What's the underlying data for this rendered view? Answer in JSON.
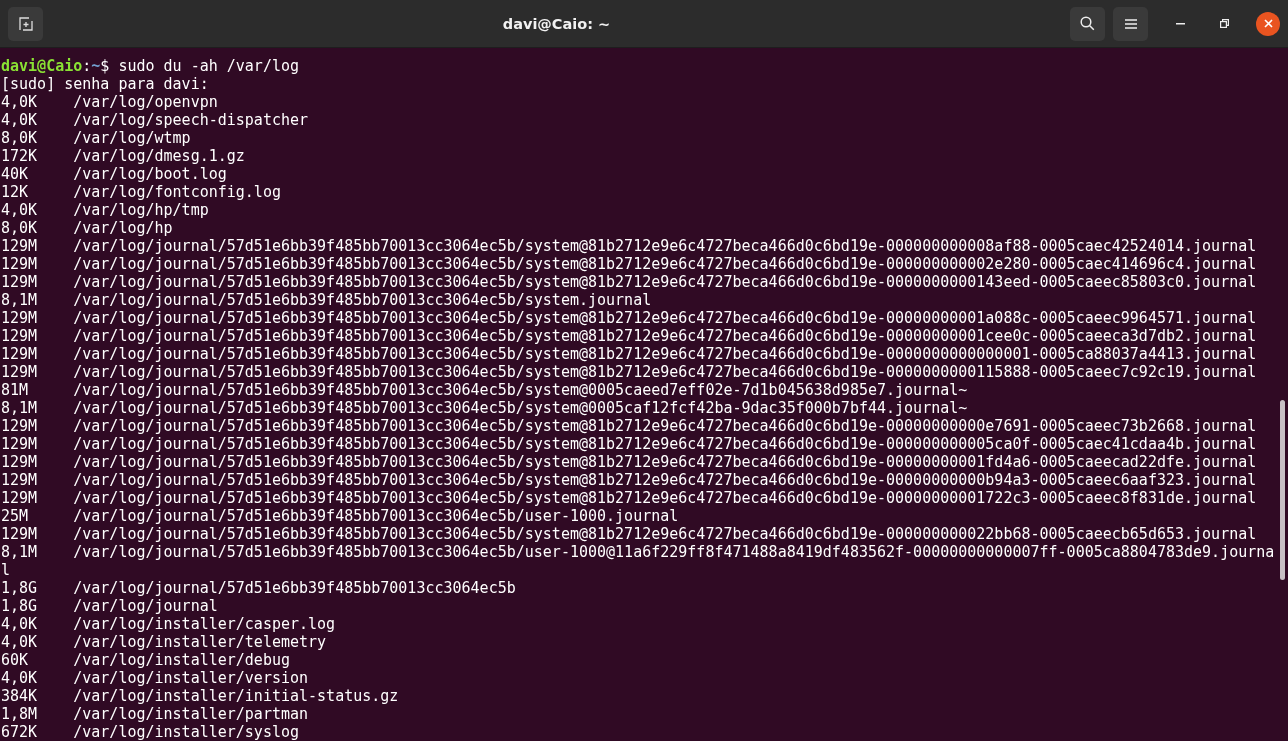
{
  "window": {
    "title": "davi@Caio: ~"
  },
  "prompt": {
    "user_host": "davi@Caio",
    "separator": ":",
    "cwd": "~",
    "symbol": "$",
    "command": "sudo du -ah /var/log"
  },
  "output": [
    {
      "kind": "text",
      "text": "[sudo] senha para davi:"
    },
    {
      "kind": "entry",
      "size": "4,0K",
      "path": "/var/log/openvpn"
    },
    {
      "kind": "entry",
      "size": "4,0K",
      "path": "/var/log/speech-dispatcher"
    },
    {
      "kind": "entry",
      "size": "8,0K",
      "path": "/var/log/wtmp"
    },
    {
      "kind": "entry",
      "size": "172K",
      "path": "/var/log/dmesg.1.gz"
    },
    {
      "kind": "entry",
      "size": "40K",
      "path": "/var/log/boot.log"
    },
    {
      "kind": "entry",
      "size": "12K",
      "path": "/var/log/fontconfig.log"
    },
    {
      "kind": "entry",
      "size": "4,0K",
      "path": "/var/log/hp/tmp"
    },
    {
      "kind": "entry",
      "size": "8,0K",
      "path": "/var/log/hp"
    },
    {
      "kind": "entry",
      "size": "129M",
      "path": "/var/log/journal/57d51e6bb39f485bb70013cc3064ec5b/system@81b2712e9e6c4727beca466d0c6bd19e-000000000008af88-0005caec42524014.journal"
    },
    {
      "kind": "entry",
      "size": "129M",
      "path": "/var/log/journal/57d51e6bb39f485bb70013cc3064ec5b/system@81b2712e9e6c4727beca466d0c6bd19e-000000000002e280-0005caec414696c4.journal"
    },
    {
      "kind": "entry",
      "size": "129M",
      "path": "/var/log/journal/57d51e6bb39f485bb70013cc3064ec5b/system@81b2712e9e6c4727beca466d0c6bd19e-0000000000143eed-0005caeec85803c0.journal"
    },
    {
      "kind": "entry",
      "size": "8,1M",
      "path": "/var/log/journal/57d51e6bb39f485bb70013cc3064ec5b/system.journal"
    },
    {
      "kind": "entry",
      "size": "129M",
      "path": "/var/log/journal/57d51e6bb39f485bb70013cc3064ec5b/system@81b2712e9e6c4727beca466d0c6bd19e-00000000001a088c-0005caeec9964571.journal"
    },
    {
      "kind": "entry",
      "size": "129M",
      "path": "/var/log/journal/57d51e6bb39f485bb70013cc3064ec5b/system@81b2712e9e6c4727beca466d0c6bd19e-00000000001cee0c-0005caeeca3d7db2.journal"
    },
    {
      "kind": "entry",
      "size": "129M",
      "path": "/var/log/journal/57d51e6bb39f485bb70013cc3064ec5b/system@81b2712e9e6c4727beca466d0c6bd19e-0000000000000001-0005ca88037a4413.journal"
    },
    {
      "kind": "entry",
      "size": "129M",
      "path": "/var/log/journal/57d51e6bb39f485bb70013cc3064ec5b/system@81b2712e9e6c4727beca466d0c6bd19e-0000000000115888-0005caeec7c92c19.journal"
    },
    {
      "kind": "entry",
      "size": "81M",
      "path": "/var/log/journal/57d51e6bb39f485bb70013cc3064ec5b/system@0005caeed7eff02e-7d1b045638d985e7.journal~"
    },
    {
      "kind": "entry",
      "size": "8,1M",
      "path": "/var/log/journal/57d51e6bb39f485bb70013cc3064ec5b/system@0005caf12fcf42ba-9dac35f000b7bf44.journal~"
    },
    {
      "kind": "entry",
      "size": "129M",
      "path": "/var/log/journal/57d51e6bb39f485bb70013cc3064ec5b/system@81b2712e9e6c4727beca466d0c6bd19e-00000000000e7691-0005caeec73b2668.journal"
    },
    {
      "kind": "entry",
      "size": "129M",
      "path": "/var/log/journal/57d51e6bb39f485bb70013cc3064ec5b/system@81b2712e9e6c4727beca466d0c6bd19e-000000000005ca0f-0005caec41cdaa4b.journal"
    },
    {
      "kind": "entry",
      "size": "129M",
      "path": "/var/log/journal/57d51e6bb39f485bb70013cc3064ec5b/system@81b2712e9e6c4727beca466d0c6bd19e-00000000001fd4a6-0005caeecad22dfe.journal"
    },
    {
      "kind": "entry",
      "size": "129M",
      "path": "/var/log/journal/57d51e6bb39f485bb70013cc3064ec5b/system@81b2712e9e6c4727beca466d0c6bd19e-00000000000b94a3-0005caeec6aaf323.journal"
    },
    {
      "kind": "entry",
      "size": "129M",
      "path": "/var/log/journal/57d51e6bb39f485bb70013cc3064ec5b/system@81b2712e9e6c4727beca466d0c6bd19e-00000000001722c3-0005caeec8f831de.journal"
    },
    {
      "kind": "entry",
      "size": "25M",
      "path": "/var/log/journal/57d51e6bb39f485bb70013cc3064ec5b/user-1000.journal"
    },
    {
      "kind": "entry",
      "size": "129M",
      "path": "/var/log/journal/57d51e6bb39f485bb70013cc3064ec5b/system@81b2712e9e6c4727beca466d0c6bd19e-000000000022bb68-0005caeecb65d653.journal"
    },
    {
      "kind": "entry",
      "size": "8,1M",
      "path": "/var/log/journal/57d51e6bb39f485bb70013cc3064ec5b/user-1000@11a6f229ff8f471488a8419df483562f-00000000000007ff-0005ca8804783de9.journa"
    },
    {
      "kind": "text",
      "text": "l"
    },
    {
      "kind": "entry",
      "size": "1,8G",
      "path": "/var/log/journal/57d51e6bb39f485bb70013cc3064ec5b"
    },
    {
      "kind": "entry",
      "size": "1,8G",
      "path": "/var/log/journal"
    },
    {
      "kind": "entry",
      "size": "4,0K",
      "path": "/var/log/installer/casper.log"
    },
    {
      "kind": "entry",
      "size": "4,0K",
      "path": "/var/log/installer/telemetry"
    },
    {
      "kind": "entry",
      "size": "60K",
      "path": "/var/log/installer/debug"
    },
    {
      "kind": "entry",
      "size": "4,0K",
      "path": "/var/log/installer/version"
    },
    {
      "kind": "entry",
      "size": "384K",
      "path": "/var/log/installer/initial-status.gz"
    },
    {
      "kind": "entry",
      "size": "1,8M",
      "path": "/var/log/installer/partman"
    },
    {
      "kind": "entry",
      "size": "672K",
      "path": "/var/log/installer/syslog"
    }
  ]
}
